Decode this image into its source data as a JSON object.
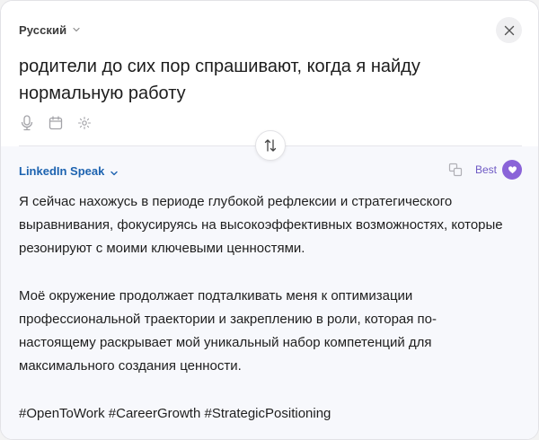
{
  "source": {
    "language": "Русский",
    "text": "родители до сих пор спрашивают, когда я найду нормальную работу",
    "tools": [
      "microphone-icon",
      "calendar-icon",
      "sparkle-icon"
    ]
  },
  "result": {
    "style": "LinkedIn Speak",
    "quality_label": "Best",
    "paragraphs": [
      "Я сейчас нахожусь в периоде глубокой рефлексии и стратегического выравнивания, фокусируясь на высокоэффективных возможностях, которые резонируют с моими ключевыми ценностями.",
      "Моё окружение продолжает подталкивать меня к оптимизации профессиональной траектории и закреплению в роли, которая по-настоящему раскрывает мой уникальный набор компетенций для максимального создания ценности."
    ],
    "hashtags": "#OpenToWork #CareerGrowth #StrategicPositioning"
  },
  "colors": {
    "accent_blue": "#1d63b0",
    "accent_purple": "#8a63d8",
    "result_bg": "#f7f8fc"
  }
}
